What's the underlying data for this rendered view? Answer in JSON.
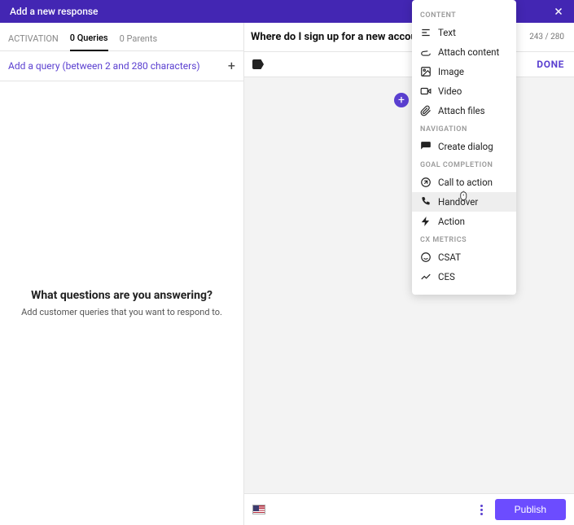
{
  "titlebar": {
    "title": "Add a new response"
  },
  "left": {
    "tabs": {
      "activation": "ACTIVATION",
      "queries": "0 Queries",
      "parents": "0 Parents"
    },
    "add_placeholder": "Add a query (between 2 and 280 characters)",
    "empty_heading": "What questions are you answering?",
    "empty_sub": "Add customer queries that you want to respond to."
  },
  "right": {
    "question": "Where do I sign up for a new account?",
    "char_count": "243 / 280",
    "done_label": "DONE",
    "publish_label": "Publish"
  },
  "menu": {
    "sections": [
      {
        "label": "CONTENT",
        "items": [
          {
            "icon": "text-icon",
            "label": "Text"
          },
          {
            "icon": "attach-icon",
            "label": "Attach content"
          },
          {
            "icon": "image-icon",
            "label": "Image"
          },
          {
            "icon": "video-icon",
            "label": "Video"
          },
          {
            "icon": "file-icon",
            "label": "Attach files"
          }
        ]
      },
      {
        "label": "NAVIGATION",
        "items": [
          {
            "icon": "dialog-icon",
            "label": "Create dialog"
          }
        ]
      },
      {
        "label": "GOAL COMPLETION",
        "items": [
          {
            "icon": "cta-icon",
            "label": "Call to action"
          },
          {
            "icon": "handover-icon",
            "label": "Handover",
            "highlight": true
          },
          {
            "icon": "action-icon",
            "label": "Action"
          }
        ]
      },
      {
        "label": "CX METRICS",
        "items": [
          {
            "icon": "csat-icon",
            "label": "CSAT"
          },
          {
            "icon": "ces-icon",
            "label": "CES"
          }
        ]
      }
    ]
  }
}
